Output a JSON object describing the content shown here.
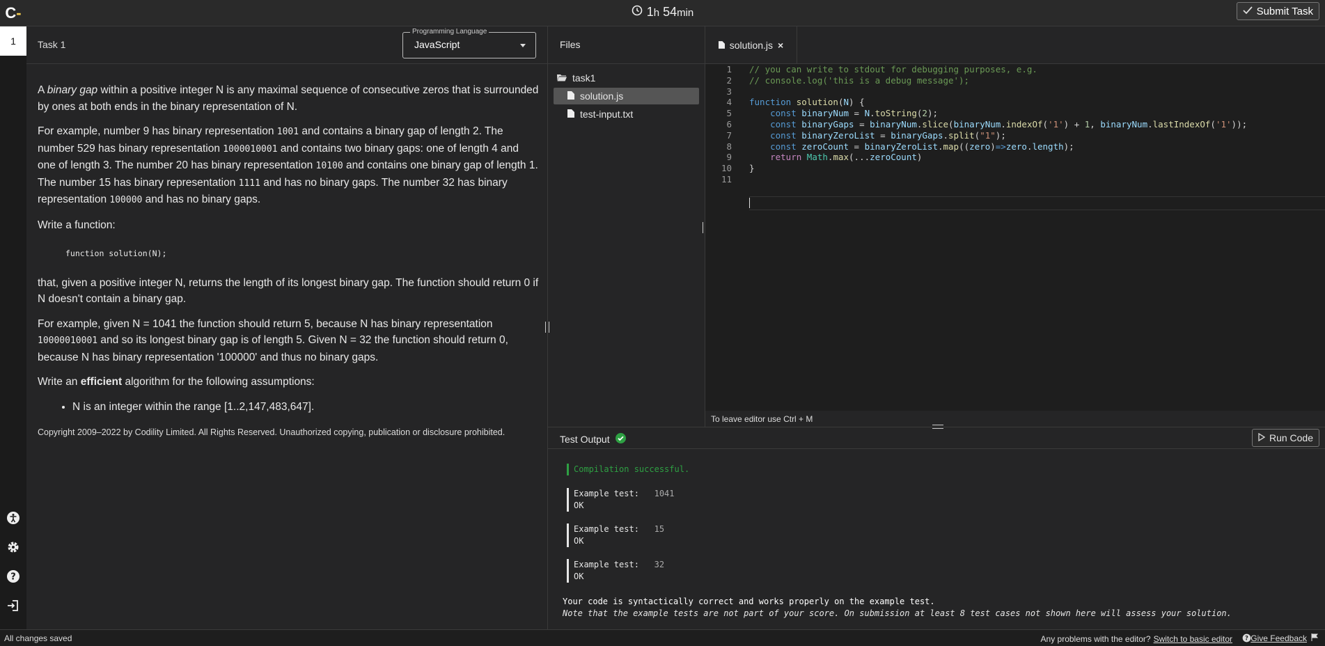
{
  "app": {
    "logo_letter": "C",
    "logo_dash": "-"
  },
  "timer": {
    "hours": "1",
    "h_unit": "h",
    "minutes": "54",
    "m_unit": "min"
  },
  "toolbar": {
    "submit_label": "Submit Task"
  },
  "rail": {
    "task_number": "1"
  },
  "task": {
    "title": "Task 1",
    "language_legend": "Programming Language",
    "language_value": "JavaScript",
    "p1_a": "A ",
    "p1_em": "binary gap",
    "p1_b": " within a positive integer N is any maximal sequence of consecutive zeros that is surrounded by ones at both ends in the binary representation of N.",
    "p2_a": "For example, number 9 has binary representation ",
    "p2_b1": "1001",
    "p2_b": " and contains a binary gap of length 2. The number 529 has binary representation ",
    "p2_b2": "1000010001",
    "p2_c": " and contains two binary gaps: one of length 4 and one of length 3. The number 20 has binary representation ",
    "p2_b3": "10100",
    "p2_d": " and contains one binary gap of length 1. The number 15 has binary representation ",
    "p2_b4": "1111",
    "p2_e": " and has no binary gaps. The number 32 has binary representation ",
    "p2_b5": "100000",
    "p2_f": " and has no binary gaps.",
    "p3": "Write a function:",
    "signature": "function solution(N);",
    "p4": "that, given a positive integer N, returns the length of its longest binary gap. The function should return 0 if N doesn't contain a binary gap.",
    "p5_a": "For example, given N = 1041 the function should return 5, because N has binary representation ",
    "p5_b1": "10000010001",
    "p5_b": " and so its longest binary gap is of length 5. Given N = 32 the function should return 0, because N has binary representation '100000' and thus no binary gaps.",
    "p6_a": "Write an ",
    "p6_strong": "efficient",
    "p6_b": " algorithm for the following assumptions:",
    "assumption": "N is an integer within the range [1..2,147,483,647].",
    "copyright": "Copyright 2009–2022 by Codility Limited. All Rights Reserved. Unauthorized copying, publication or disclosure prohibited."
  },
  "files": {
    "title": "Files",
    "folder": "task1",
    "items": [
      {
        "name": "solution.js",
        "selected": true
      },
      {
        "name": "test-input.txt",
        "selected": false
      }
    ]
  },
  "editor": {
    "tab_label": "solution.js",
    "tab_close": "×",
    "status": "To leave editor use Ctrl + M",
    "lines": [
      {
        "n": "1",
        "text": "// you can write to stdout for debugging purposes, e.g."
      },
      {
        "n": "2",
        "text": "// console.log('this is a debug message');"
      },
      {
        "n": "3",
        "text": ""
      },
      {
        "n": "4",
        "text": "function solution(N) {"
      },
      {
        "n": "5",
        "text": "    const binaryNum = N.toString(2);"
      },
      {
        "n": "6",
        "text": "    const binaryGaps = binaryNum.slice(binaryNum.indexOf('1') + 1, binaryNum.lastIndexOf('1'));"
      },
      {
        "n": "7",
        "text": "    const binaryZeroList = binaryGaps.split(\"1\");"
      },
      {
        "n": "8",
        "text": "    const zeroCount = binaryZeroList.map((zero)=>zero.length);"
      },
      {
        "n": "9",
        "text": "    return Math.max(...zeroCount)"
      },
      {
        "n": "10",
        "text": "}"
      },
      {
        "n": "11",
        "text": ""
      }
    ]
  },
  "output": {
    "title": "Test Output",
    "run_label": "Run Code",
    "compilation": "Compilation successful.",
    "tests": [
      {
        "label": "Example test:",
        "value": "1041",
        "result": "OK"
      },
      {
        "label": "Example test:",
        "value": "15",
        "result": "OK"
      },
      {
        "label": "Example test:",
        "value": "32",
        "result": "OK"
      }
    ],
    "summary": "Your code is syntactically correct and works properly on the example test.",
    "note": "Note that the example tests are not part of your score. On submission at least 8 test cases not shown here will assess your solution."
  },
  "statusbar": {
    "saved": "All changes saved",
    "problems": "Any problems with the editor?",
    "switch_link": "Switch to basic editor",
    "feedback": "Give Feedback"
  },
  "colors": {
    "success": "#2ea043",
    "accent": "#f2c94c"
  }
}
